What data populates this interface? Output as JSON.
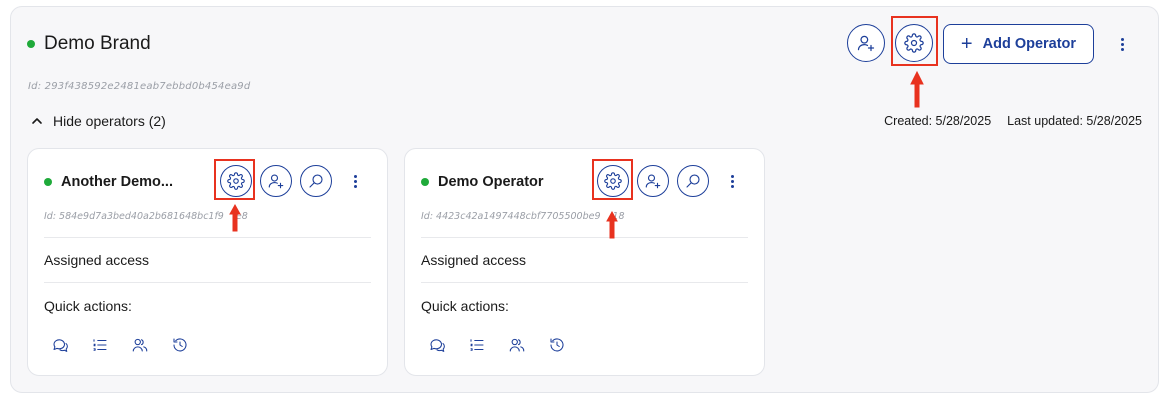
{
  "brand": {
    "name": "Demo Brand",
    "id_text": "Id: 293f438592e2481eab7ebbd0b454ea9d",
    "add_operator_label": "Add Operator",
    "hide_operators_label": "Hide operators (2)",
    "created": "Created: 5/28/2025",
    "last_updated": "Last updated: 5/28/2025",
    "status_color": "#1faa3a"
  },
  "operators": [
    {
      "name": "Another Demo...",
      "id_text": "Id: 584e9d7a3bed40a2b681648bc1f9",
      "id_tail": "e8",
      "assigned_access_label": "Assigned access",
      "quick_actions_label": "Quick actions:"
    },
    {
      "name": "Demo Operator",
      "id_text": "Id: 4423c42a1497448cbf7705500be9",
      "id_tail": "18",
      "assigned_access_label": "Assigned access",
      "quick_actions_label": "Quick actions:"
    }
  ],
  "quick_action_icons": [
    "chat-icon",
    "list-icon",
    "users-icon",
    "history-icon"
  ],
  "colors": {
    "accent": "#1d3f9a",
    "highlight": "#e8321f",
    "status": "#1faa3a"
  }
}
